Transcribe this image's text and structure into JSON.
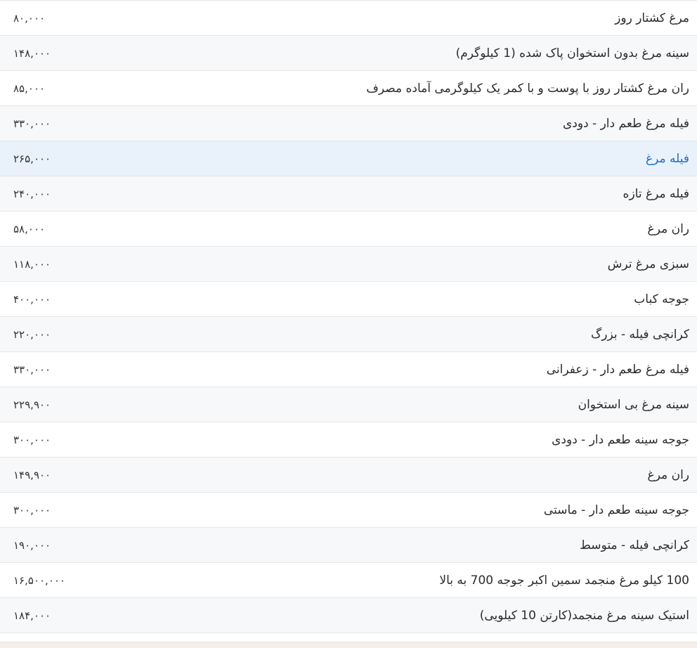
{
  "table": {
    "highlight_color": "#1f6fc6",
    "rows": [
      {
        "name": "مرغ کشتار روز",
        "price": "۸۰,۰۰۰"
      },
      {
        "name": "سینه مرغ بدون استخوان پاک شده (1 کیلوگرم)",
        "price": "۱۴۸,۰۰۰"
      },
      {
        "name": "ران مرغ کشتار روز با پوست و با کمر یک کیلوگرمی آماده مصرف",
        "price": "۸۵,۰۰۰"
      },
      {
        "name": "فیله مرغ طعم دار - دودی",
        "price": "۳۳۰,۰۰۰"
      },
      {
        "name": "فیله مرغ",
        "price": "۲۶۵,۰۰۰"
      },
      {
        "name": "فیله مرغ تازه",
        "price": "۲۴۰,۰۰۰"
      },
      {
        "name": "ران مرغ",
        "price": "۵۸,۰۰۰"
      },
      {
        "name": "سبزی مرغ ترش",
        "price": "۱۱۸,۰۰۰"
      },
      {
        "name": "جوجه کباب",
        "price": "۴۰۰,۰۰۰"
      },
      {
        "name": "کرانچی فیله - بزرگ",
        "price": "۲۲۰,۰۰۰"
      },
      {
        "name": "فیله مرغ طعم دار - زعفرانی",
        "price": "۳۳۰,۰۰۰"
      },
      {
        "name": "سینه مرغ بی استخوان",
        "price": "۲۲۹,۹۰۰"
      },
      {
        "name": "جوجه سینه طعم دار - دودی",
        "price": "۳۰۰,۰۰۰"
      },
      {
        "name": "ران مرغ",
        "price": "۱۴۹,۹۰۰"
      },
      {
        "name": "جوجه سینه طعم دار - ماستی",
        "price": "۳۰۰,۰۰۰"
      },
      {
        "name": "کرانچی فیله - متوسط",
        "price": "۱۹۰,۰۰۰"
      },
      {
        "name": "100 کیلو مرغ منجمد سمین اکبر جوجه 700 به بالا",
        "price": "۱۶,۵۰۰,۰۰۰"
      },
      {
        "name": "استیک سینه مرغ منجمد(کارتن 10 کیلویی)",
        "price": "۱۸۴,۰۰۰"
      }
    ]
  }
}
